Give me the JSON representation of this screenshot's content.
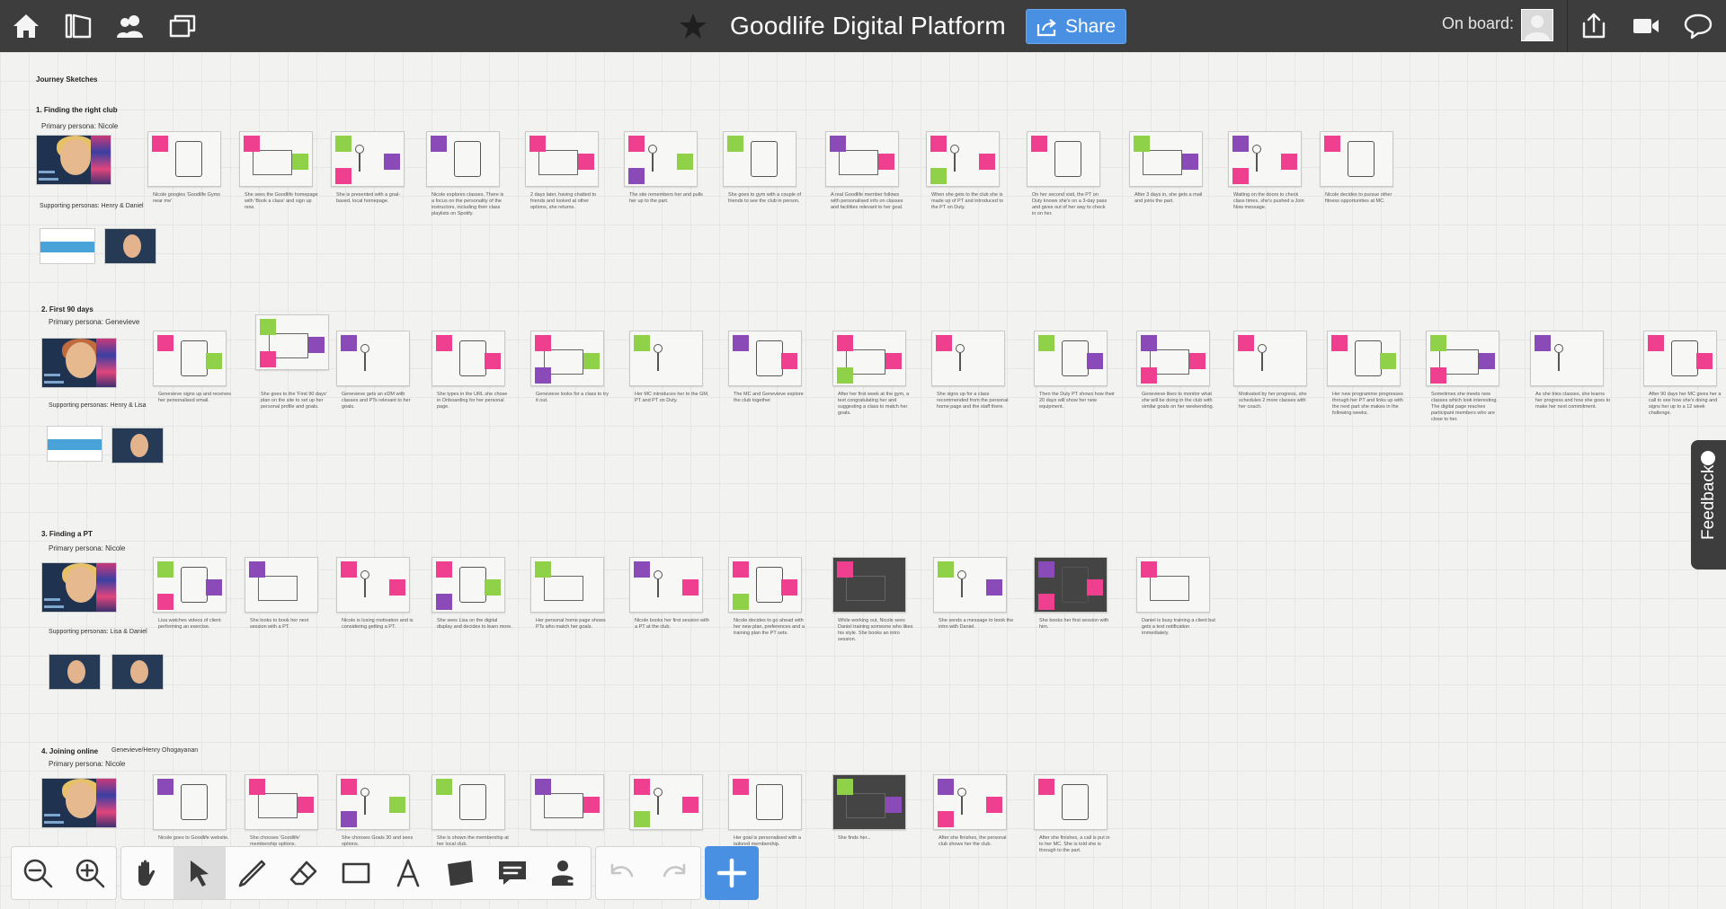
{
  "topbar": {
    "title": "Goodlife Digital Platform",
    "share_label": "Share",
    "on_board_label": "On board:",
    "icons": [
      "home-icon",
      "library-icon",
      "people-icon",
      "boards-icon",
      "star-icon",
      "export-icon",
      "video-icon",
      "chat-icon"
    ]
  },
  "canvas": {
    "board_label": "Journey Sketches",
    "sections": [
      {
        "title": "1. Finding the right club",
        "primary": "Primary persona: Nicole",
        "supporting": "Supporting personas: Henry & Daniel"
      },
      {
        "title": "2. First 90 days",
        "primary": "Primary persona: Genevieve",
        "supporting": "Supporting personas: Henry & Lisa"
      },
      {
        "title": "3. Finding a PT",
        "primary": "Primary persona: Nicole",
        "supporting": "Supporting personas: Lisa & Daniel"
      },
      {
        "title": "4. Joining online",
        "primary": "Primary persona: Nicole",
        "note": "Genevieve/Henry Ohogayanan"
      }
    ],
    "captions": {
      "row1": [
        "Nicole googles 'Goodlife Gyms near me'",
        "She sees the Goodlife homepage with 'Book a class' and sign up now.",
        "She is presented with a goal-based, local homepage.",
        "Nicole explores classes. There is a focus on the personality of the instructors, including their class playlists on Spotify.",
        "2 days later, having chatted to friends and looked at other options, she returns.",
        "The site remembers her and pulls her up to the part.",
        "She goes to gym with a couple of friends to see the club in person.",
        "A real Goodlife member follows with personalised info on classes and facilities relevant to her goal.",
        "When she gets to the club she is made up of PT and introduced to the PT on Duty.",
        "On her second visit, the PT on Duty knows she's on a 3-day pass and gives out of her way to check in on her.",
        "After 3 days in, she gets a mail and joins the part.",
        "Waiting on the doors to check class times, she's pushed a Join Now message.",
        "Nicole decides to pursue other fitness opportunities at MC."
      ],
      "row2": [
        "Genevieve signs up and receives her personalised email.",
        "She goes to the 'First 90 days' plan on the site to set up her personal profile and goals.",
        "Genevieve gets an eDM with classes and PTs relevant to her goals.",
        "She types in the URL she chose in Onboarding for her personal page.",
        "Genevieve looks for a class to try it out.",
        "Her MC introduces her to the GM, PT and PT on Duty.",
        "The MC and Genevieve explore the club together.",
        "After her first week at the gym, a text congratulating her and suggesting a class to match her goals.",
        "She signs up for a class recommended from the personal home page and the staff there.",
        "Then the Duty PT shows how their 20 days will show her new equipment.",
        "Genevieve likes to monitor what she will be doing in the club with similar goals on her weekending.",
        "Motivated by her progress, she schedules 2 more classes with her coach.",
        "Her new programme progresses through her PT and links up with the next part she makes in the following weeks.",
        "Sometimes she meets new classes which look interesting. The digital page reaches participant members who are close to her.",
        "As she tries classes, she learns her progress and how she goes to make her next commitment.",
        "After 90 days her MC gives her a call to see how she's doing and signs her up to a 12 week challenge."
      ],
      "row3": [
        "Lisa watches videos of client performing an exercise.",
        "She looks to book her next session with a PT.",
        "Nicole is losing motivation and is considering getting a PT.",
        "She sees Lisa on the digital display and decides to learn more.",
        "Her personal home page shows PTs who match her goals.",
        "Nicole books her first session with a PT at the club.",
        "Nicole decides to go ahead with her new plan, preferences and a training plan the PT sets.",
        "While working out, Nicole sees Daniel training someone who likes his style. She books an intro session.",
        "She sends a message to book the intro with Daniel.",
        "She books her first session with him.",
        "Daniel is busy training a client but gets a text notification immediately."
      ],
      "row4": [
        "Nicole goes to Goodlife website.",
        "She chooses 'Goodlife' membership options.",
        "She chooses Goals 30 and sees options.",
        "She is shown the membership at her local club.",
        "",
        "",
        "Her goal is personalised with a tailored membership.",
        "She finds her...",
        "After she finishes, the personal club shows her the club.",
        "After she finishes, a call is put in to her MC. She is told she is through to the part."
      ]
    }
  },
  "feedback": {
    "label": "Feedback"
  },
  "toolbar": {
    "tools": [
      "zoom-out-icon",
      "zoom-in-icon",
      "hand-icon",
      "select-arrow-icon",
      "pen-icon",
      "eraser-icon",
      "rectangle-icon",
      "text-icon",
      "note-icon",
      "comment-icon",
      "stamp-icon"
    ],
    "history": [
      "undo-icon",
      "redo-icon"
    ],
    "add": "plus-icon",
    "active_tool": "select-arrow-icon"
  },
  "colors": {
    "topbar": "#3d3d3d",
    "accent": "#4a90e2",
    "sticky_pink": "#ef3f8f",
    "sticky_green": "#8fd24a",
    "sticky_violet": "#8a4bb8"
  }
}
